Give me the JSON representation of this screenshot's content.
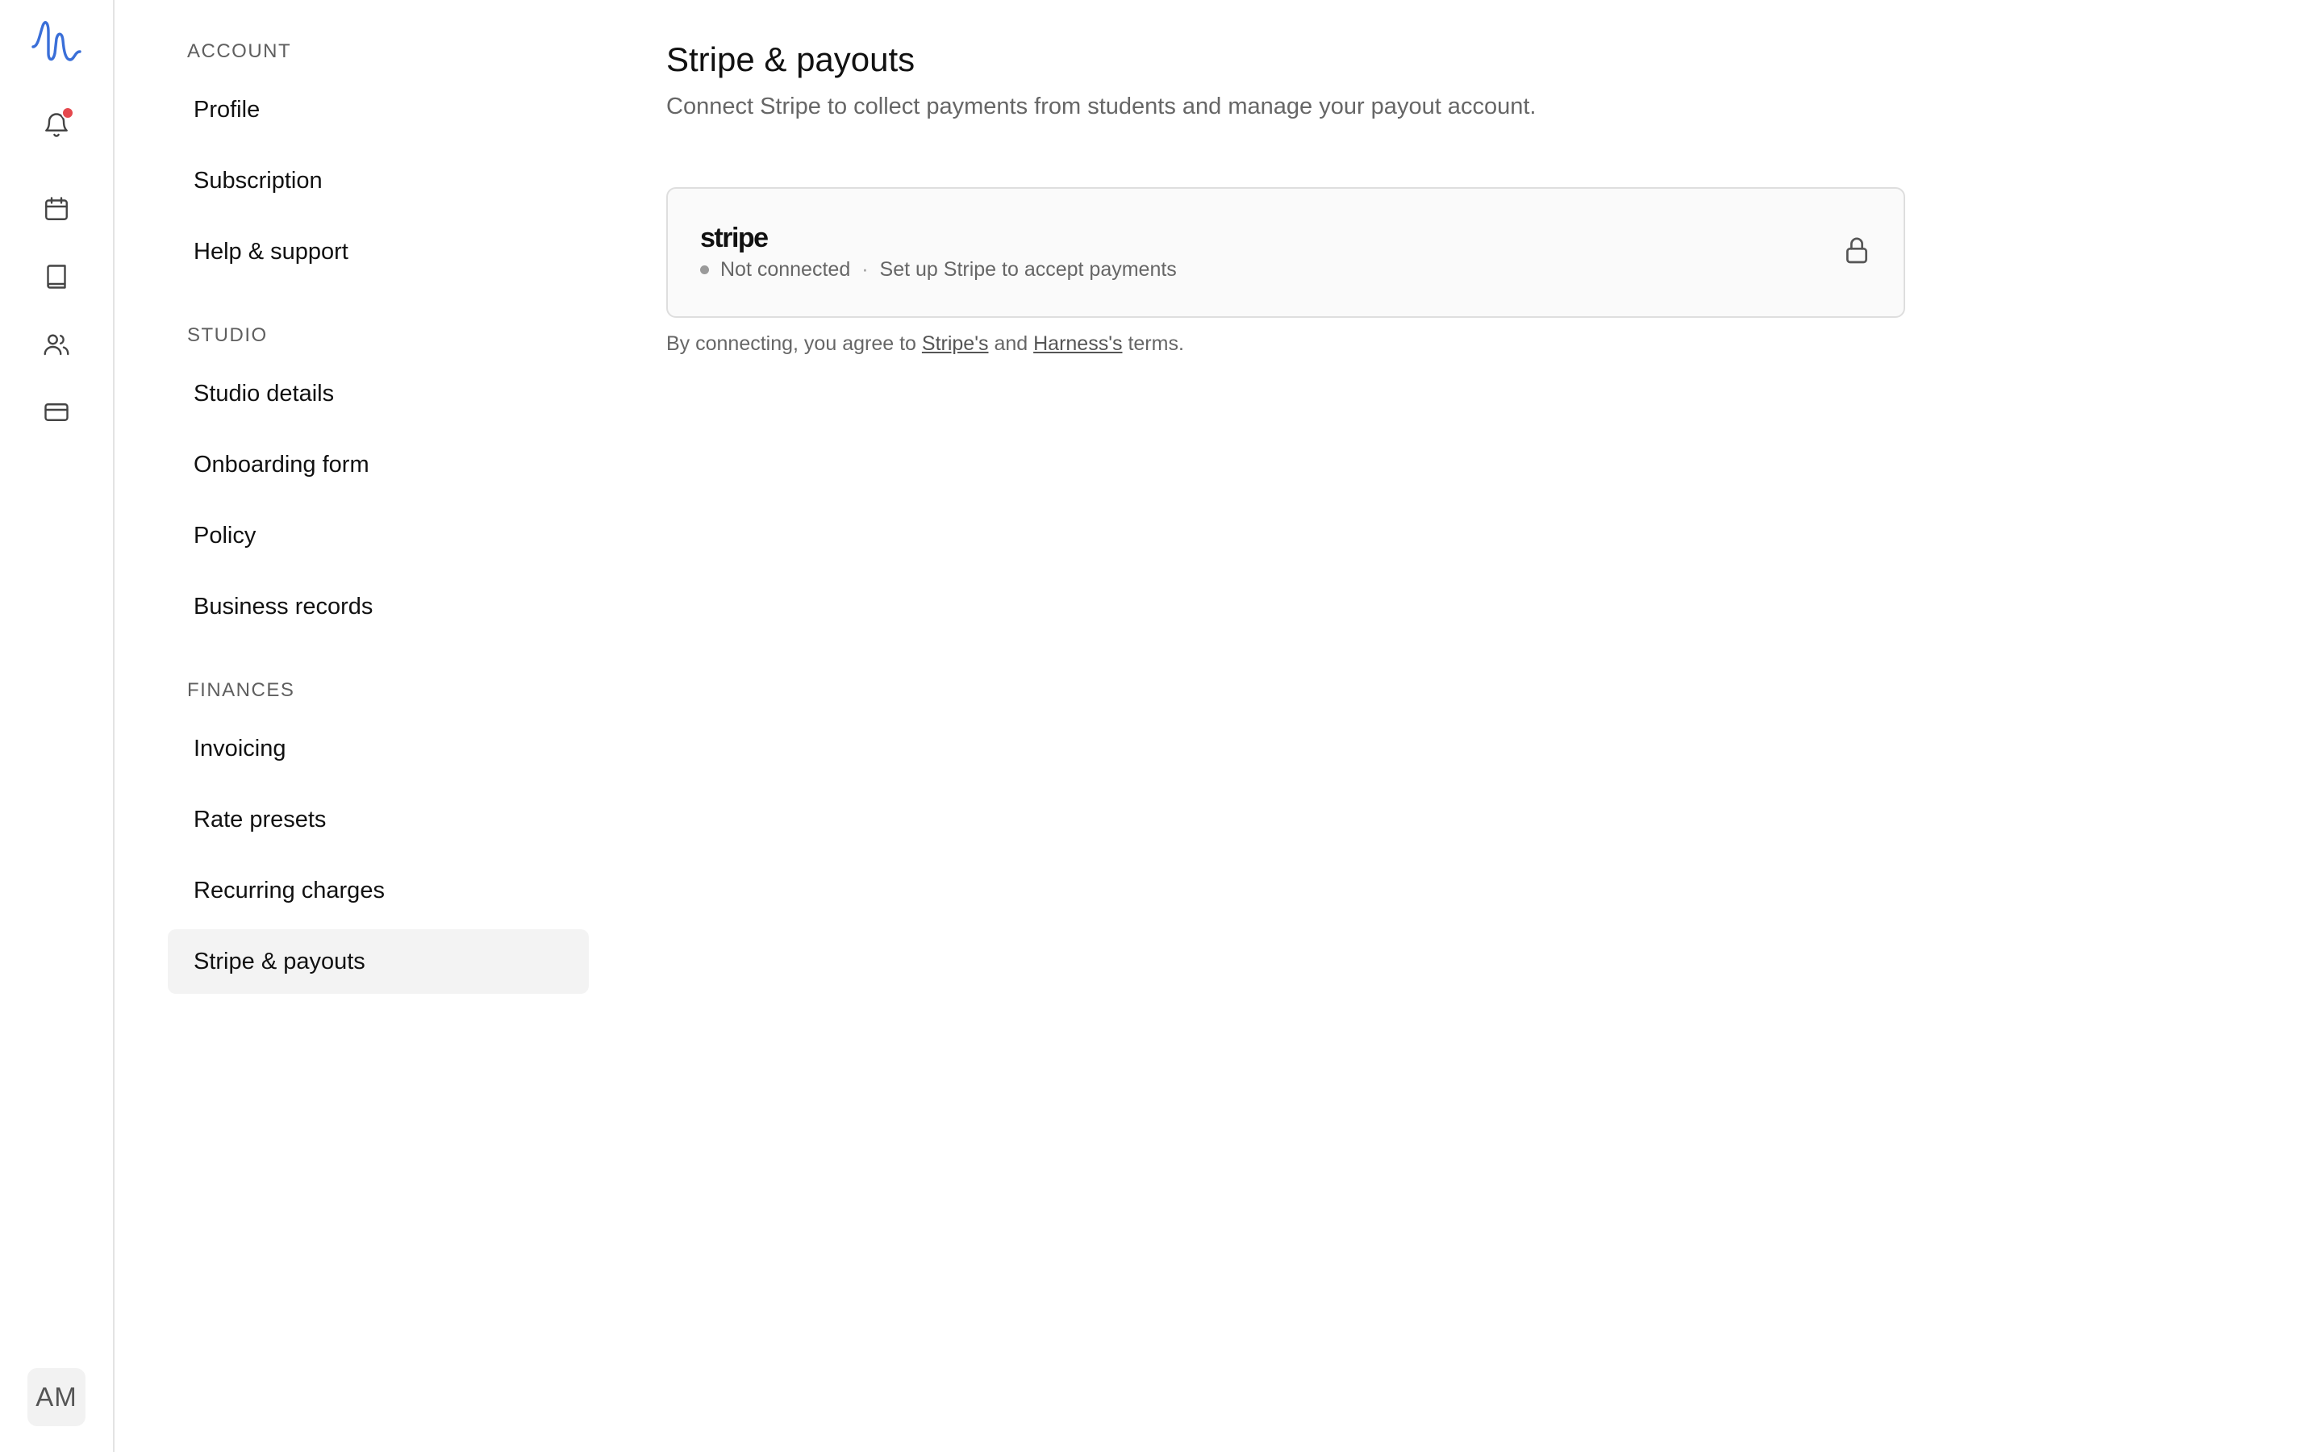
{
  "rail": {
    "icons": [
      "logo-wave-icon",
      "bell-icon",
      "calendar-icon",
      "book-icon",
      "users-icon",
      "credit-card-icon"
    ],
    "notification_dot_color": "#e5484d",
    "brand_color": "#3a6fd8",
    "avatar_initials": "AM"
  },
  "nav": {
    "sections": [
      {
        "label": "ACCOUNT",
        "items": [
          "Profile",
          "Subscription",
          "Help & support"
        ]
      },
      {
        "label": "STUDIO",
        "items": [
          "Studio details",
          "Onboarding form",
          "Policy",
          "Business records"
        ]
      },
      {
        "label": "FINANCES",
        "items": [
          "Invoicing",
          "Rate presets",
          "Recurring charges",
          "Stripe & payouts"
        ]
      }
    ],
    "active_item": "Stripe & payouts"
  },
  "main": {
    "title": "Stripe & payouts",
    "subtitle": "Connect Stripe to collect payments from students and manage your payout account.",
    "stripe_card": {
      "logo_text": "stripe",
      "status": "Not connected",
      "separator": "·",
      "hint": "Set up Stripe to accept payments",
      "lock_icon": "lock-icon"
    },
    "terms": {
      "prefix": "By connecting, you agree to",
      "link_stripe": "Stripe's",
      "middle": "and",
      "link_harness": "Harness's",
      "suffix": "terms."
    }
  }
}
